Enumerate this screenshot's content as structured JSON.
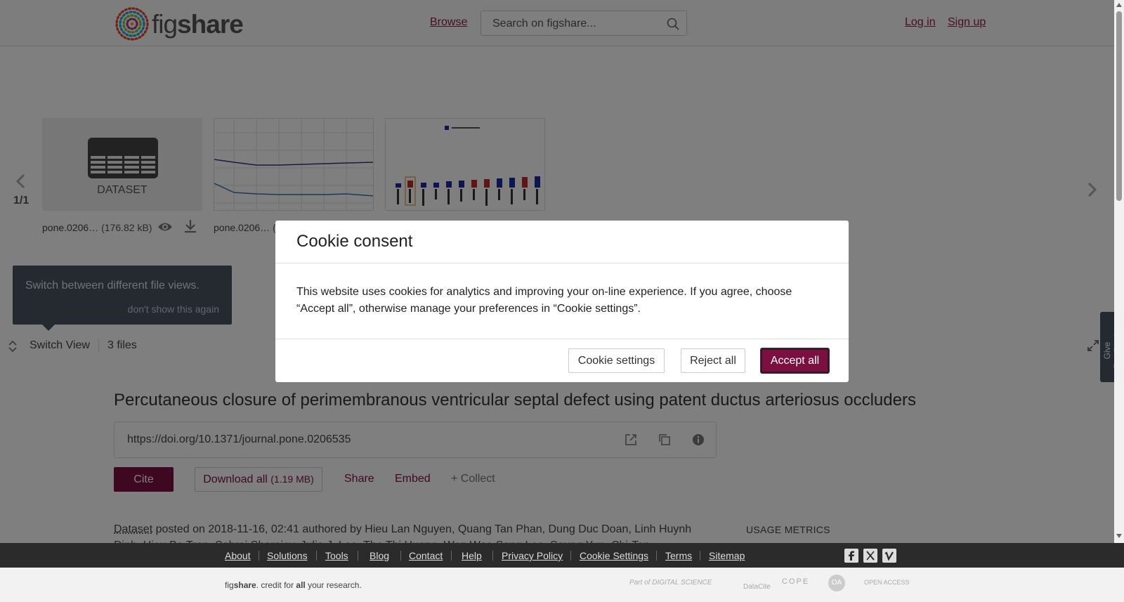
{
  "header": {
    "logo_text_a": "fig",
    "logo_text_b": "share",
    "browse": "Browse",
    "search_placeholder": "Search on figshare...",
    "login": "Log in",
    "signup": "Sign up"
  },
  "viewer": {
    "pager": "1/1",
    "dataset_label": "DATASET",
    "files": [
      {
        "name": "pone.0206…",
        "size": "(176.82 kB)"
      },
      {
        "name": "pone.0206…",
        "size": "("
      }
    ],
    "tooltip_message": "Switch between different file views.",
    "tooltip_dismiss": "don't show this again",
    "switch_view": "Switch View",
    "files_count": "3 files",
    "feedback": "Give Feedback"
  },
  "article": {
    "title": "Percutaneous closure of perimembranous ventricular septal defect using patent ductus arteriosus occluders",
    "doi": "https://doi.org/10.1371/journal.pone.0206535",
    "cite": "Cite",
    "download_all": "Download all",
    "download_size": "(1.19 MB)",
    "share": "Share",
    "embed": "Embed",
    "collect": "+ Collect",
    "type": "Dataset",
    "posted_text": " posted on 2018-11-16, 02:41 authored by Hieu Lan Nguyen, Quang Tan Phan, Dung Duc Doan, Linh Huynh",
    "posted_text_2": "Dinh, Hieu Ba Tran, Sahrai Sharaiev, Julia J. Lee, Tho Thi Huong, Won Woo Sang Lee, Seung Yun, Chi-Tan",
    "usage_metrics": "USAGE METRICS"
  },
  "modal": {
    "title": "Cookie consent",
    "body": "This website uses cookies for analytics and improving your on-line experience. If you agree, choose “Accept all”, otherwise manage your preferences in “Cookie settings”.",
    "settings": "Cookie settings",
    "reject": "Reject all",
    "accept": "Accept all"
  },
  "footer": {
    "nav": [
      "About",
      "Solutions",
      "Tools",
      "Blog",
      "Contact",
      "Help",
      "Privacy Policy",
      "Cookie Settings",
      "Terms",
      "Sitemap"
    ],
    "tagline_a": "fig",
    "tagline_b": "share",
    "tagline_c": ". credit for ",
    "tagline_d": "all",
    "tagline_e": " your research.",
    "partners": [
      "Part of DIGITAL SCIENCE",
      "DataCite",
      "COPE",
      "OA",
      "OPEN ACCESS"
    ]
  },
  "colors": {
    "brand": "#7b1040",
    "link": "#8a1e4b",
    "footer_dark": "#2b2b2b",
    "tooltip": "#4a5560"
  }
}
